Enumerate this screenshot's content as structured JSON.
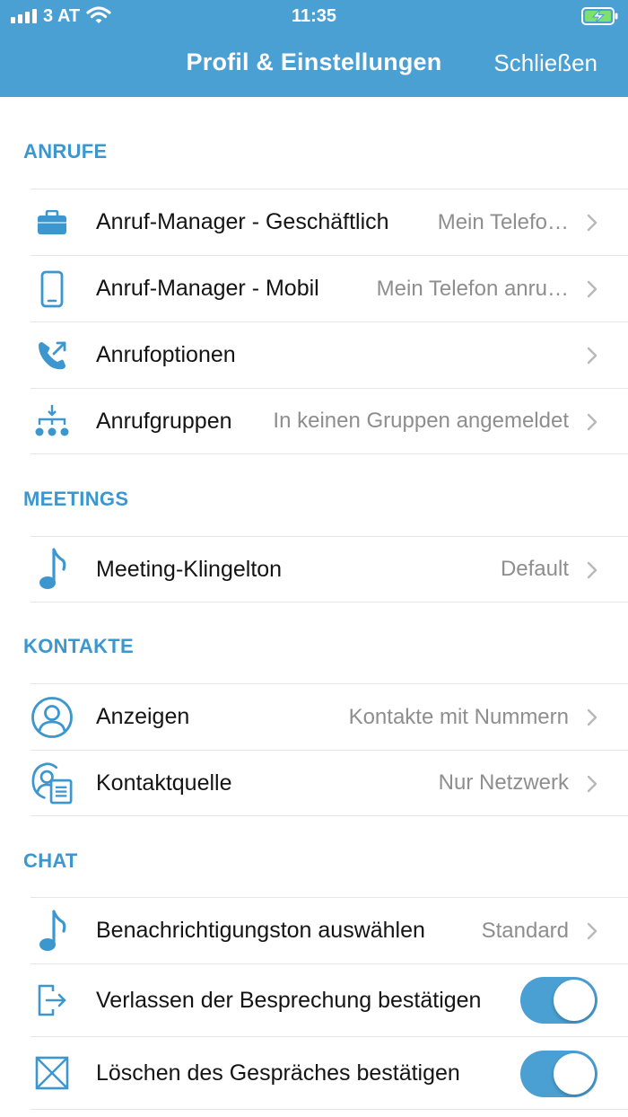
{
  "status_bar": {
    "carrier": "3 AT",
    "time": "11:35",
    "icons": [
      "signal-icon",
      "wifi-icon",
      "battery-charging-icon"
    ]
  },
  "nav": {
    "title": "Profil & Einstellungen",
    "close_label": "Schließen"
  },
  "colors": {
    "accent": "#4a9fd3",
    "section_header": "#3d97cf",
    "value_text": "#8e8e8e"
  },
  "sections": {
    "calls": {
      "header": "ANRUFE",
      "items": [
        {
          "icon": "briefcase-icon",
          "label": "Anruf-Manager - Geschäftlich",
          "value": "Mein Telefo…"
        },
        {
          "icon": "mobile-phone-icon",
          "label": "Anruf-Manager - Mobil",
          "value": "Mein Telefon anru…"
        },
        {
          "icon": "call-forward-icon",
          "label": "Anrufoptionen",
          "value": ""
        },
        {
          "icon": "call-groups-icon",
          "label": "Anrufgruppen",
          "value": "In keinen Gruppen angemeldet"
        }
      ]
    },
    "meetings": {
      "header": "MEETINGS",
      "items": [
        {
          "icon": "music-note-icon",
          "label": "Meeting-Klingelton",
          "value": "Default"
        }
      ]
    },
    "contacts": {
      "header": "KONTAKTE",
      "items": [
        {
          "icon": "user-circle-icon",
          "label": "Anzeigen",
          "value": "Kontakte mit Nummern"
        },
        {
          "icon": "contact-source-icon",
          "label": "Kontaktquelle",
          "value": "Nur Netzwerk"
        }
      ]
    },
    "chat": {
      "header": "CHAT",
      "items": [
        {
          "icon": "music-note-icon",
          "label": "Benachrichtigungston auswählen",
          "value": "Standard"
        },
        {
          "icon": "exit-icon",
          "label": "Verlassen der Besprechung bestätigen",
          "toggle": true
        },
        {
          "icon": "delete-box-icon",
          "label": "Löschen des Gespräches bestätigen",
          "toggle": true
        }
      ]
    }
  }
}
